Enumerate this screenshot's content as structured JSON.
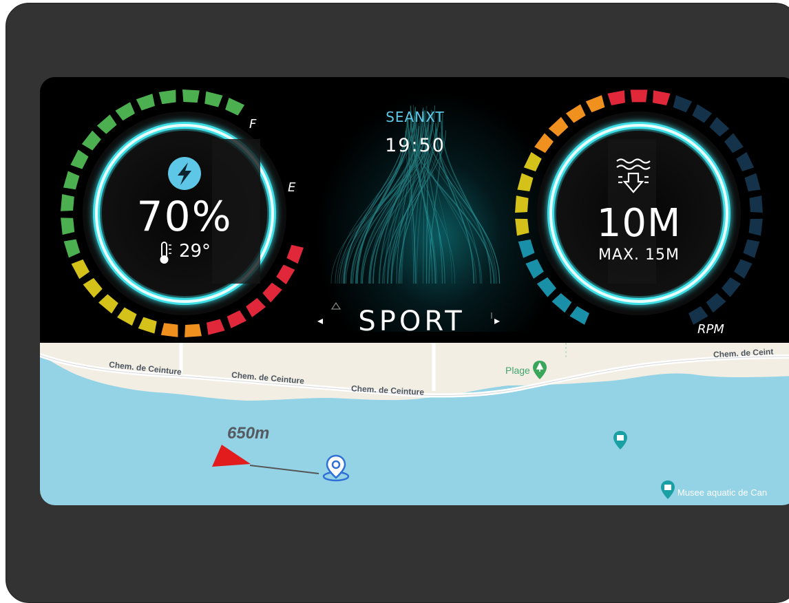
{
  "brand": "SEANXT",
  "clock": "19:50",
  "battery": {
    "percent": "70%",
    "temperature": "29°",
    "level": 0.7,
    "full_label": "F",
    "empty_label": "E"
  },
  "depth": {
    "value": "10M",
    "max": "MAX. 15M"
  },
  "rpm_label": "RPM",
  "mode": {
    "label": "SPORT",
    "prev": "◂",
    "next": "▸"
  },
  "map": {
    "roads": [
      "Chem. de Ceinture",
      "Chem. de Ceinture",
      "Chem. de Ceinture",
      "Chem. de Ceint"
    ],
    "poi_beach": "Plage",
    "poi_museum": "Musee aquatic de Can",
    "distance": "650m"
  },
  "colors": {
    "green": "#4caf50",
    "yellow": "#d4c21a",
    "orange": "#f0901e",
    "red": "#e0283a",
    "teal": "#1a8fa8",
    "navy": "#14324a",
    "glow": "#3fe0e8",
    "water": "#94d3e6",
    "land": "#f2eee4"
  },
  "icons": [
    "bolt-icon",
    "thermometer-icon",
    "depth-down-icon",
    "location-pin-icon",
    "heading-arrow-icon",
    "beach-pin-icon",
    "museum-pin-icon"
  ]
}
